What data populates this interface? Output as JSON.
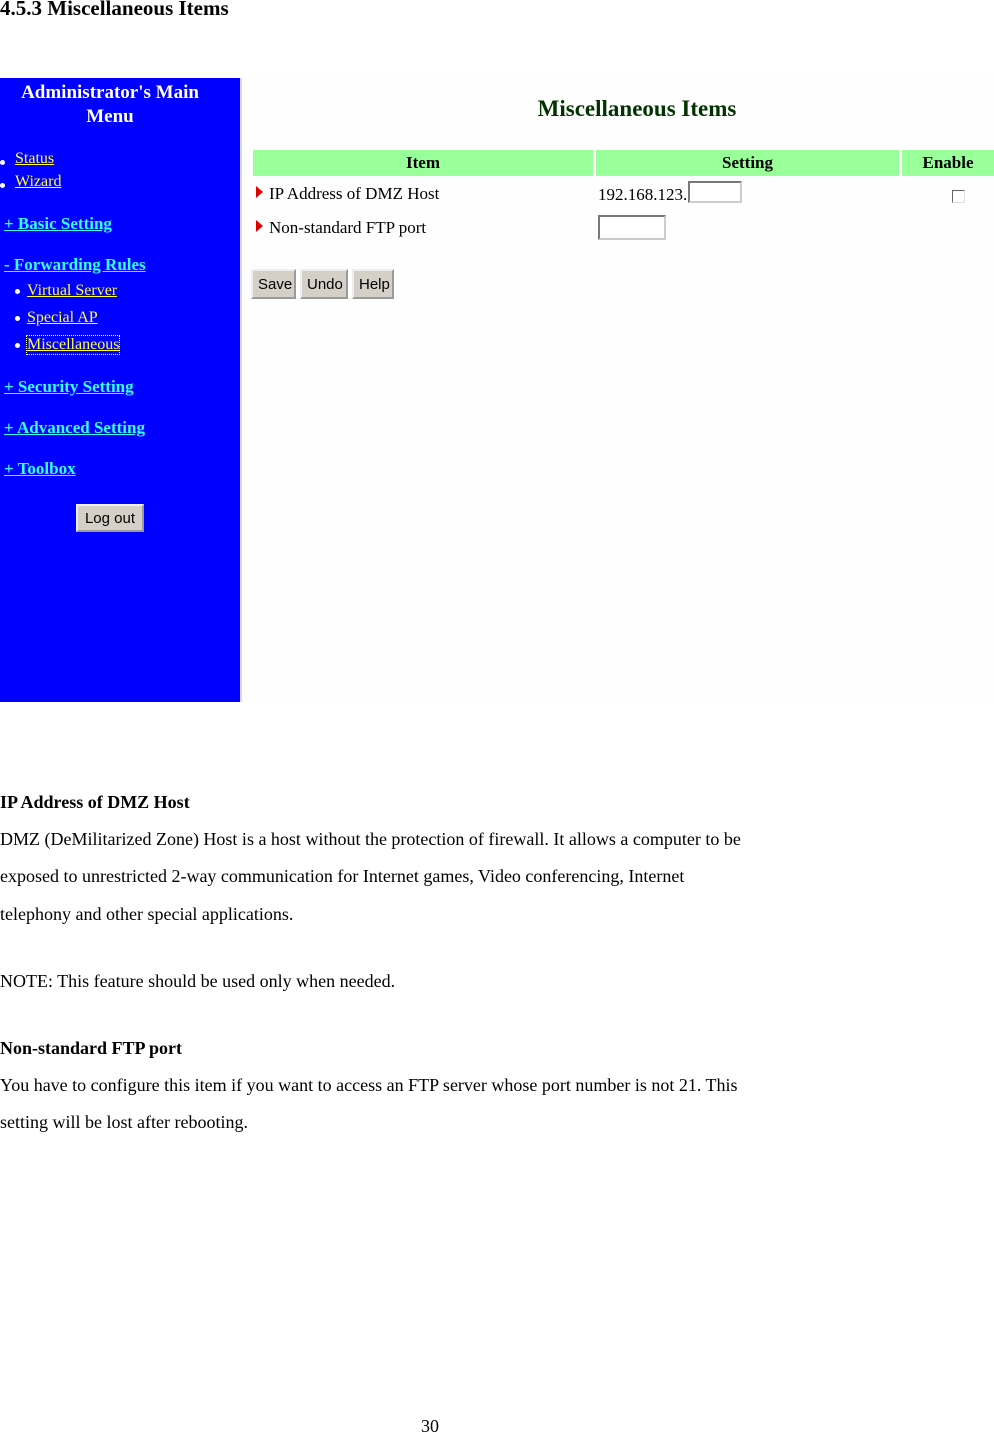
{
  "section_title": "4.5.3 Miscellaneous Items",
  "sidebar": {
    "title_line1": "Administrator's Main",
    "title_line2": "Menu",
    "items": [
      {
        "label": "Status"
      },
      {
        "label": "Wizard"
      },
      {
        "label": "+ Basic Setting"
      },
      {
        "label": "- Forwarding Rules"
      },
      {
        "label": "Virtual Server"
      },
      {
        "label": "Special AP"
      },
      {
        "label": "Miscellaneous"
      },
      {
        "label": "+ Security Setting"
      },
      {
        "label": "+ Advanced Setting"
      },
      {
        "label": "+ Toolbox"
      }
    ],
    "logout_label": "Log out"
  },
  "main": {
    "title": "Miscellaneous Items",
    "columns": [
      "Item",
      "Setting",
      "Enable"
    ],
    "rows": [
      {
        "item": "IP Address of DMZ Host",
        "prefix": "192.168.123.",
        "value": "",
        "enabled": false
      },
      {
        "item": "Non-standard FTP port",
        "value": ""
      }
    ],
    "buttons": {
      "save": "Save",
      "undo": "Undo",
      "help": "Help"
    }
  },
  "doc": {
    "dmz_heading": "IP Address of DMZ Host",
    "dmz_lines": [
      "DMZ (DeMilitarized Zone) Host is a host without the protection of firewall. It allows a computer to be",
      "exposed to unrestricted 2-way communication for Internet games, Video conferencing, Internet",
      "telephony and other special applications."
    ],
    "note": "NOTE: This feature should be used only when needed.",
    "ftp_heading": "Non-standard FTP port",
    "ftp_lines": [
      "You have to configure this item if you want to access an FTP server whose port number is not 21. This",
      "setting will be lost after rebooting."
    ],
    "page_number": "30"
  }
}
